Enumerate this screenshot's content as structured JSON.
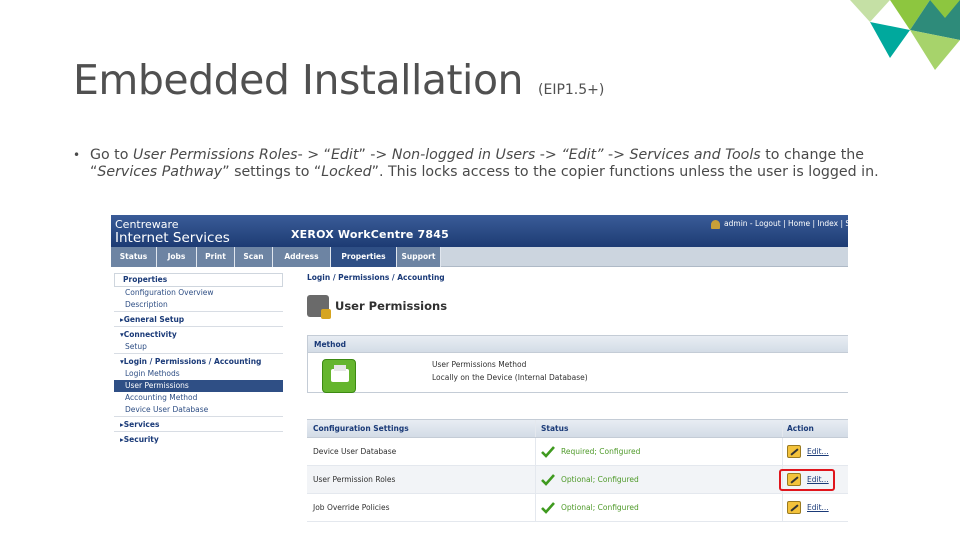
{
  "slide": {
    "title": "Embedded Installation",
    "subtitle": "(EIP1.5+)",
    "bullet": {
      "marker": "•",
      "parts": [
        {
          "text": "Go to ",
          "italic": false
        },
        {
          "text": "User Permissions Roles",
          "italic": true
        },
        {
          "text": "- > “",
          "italic": false
        },
        {
          "text": "Edit",
          "italic": true
        },
        {
          "text": "” -> ",
          "italic": false
        },
        {
          "text": "Non-logged in Users",
          "italic": true
        },
        {
          "text": " -> ",
          "italic": false
        },
        {
          "text": "“Edit”",
          "italic": true
        },
        {
          "text": " -> ",
          "italic": false
        },
        {
          "text": "Services and Tools",
          "italic": true
        },
        {
          "text": " to change the “",
          "italic": false
        },
        {
          "text": "Services Pathway",
          "italic": true
        },
        {
          "text": "” settings to “",
          "italic": false
        },
        {
          "text": "Locked",
          "italic": true
        },
        {
          "text": "”. This locks access to the copier functions unless the user is logged in.",
          "italic": false
        }
      ]
    },
    "accent_colors": [
      "#8dc63f",
      "#00a99d",
      "#c5e0a5",
      "#2e8b7a"
    ]
  },
  "screenshot": {
    "brand_line1": "Centreware",
    "brand_line2": "Internet Services",
    "device_name": "XEROX WorkCentre 7845",
    "user_links": "admin - Logout | Home | Index | Site Map",
    "tabs": [
      {
        "label": "Status",
        "active": false
      },
      {
        "label": "Jobs",
        "active": false
      },
      {
        "label": "Print",
        "active": false
      },
      {
        "label": "Scan",
        "active": false
      },
      {
        "label": "Address Book",
        "active": false
      },
      {
        "label": "Properties",
        "active": true
      },
      {
        "label": "Support",
        "active": false
      }
    ],
    "nav": {
      "header": "Properties",
      "items": [
        {
          "label": "Configuration Overview",
          "type": "item"
        },
        {
          "label": "Description",
          "type": "item"
        },
        {
          "label": "▸General Setup",
          "type": "group"
        },
        {
          "label": "▾Connectivity",
          "type": "group"
        },
        {
          "label": "Setup",
          "type": "item"
        },
        {
          "label": "▾Login / Permissions / Accounting",
          "type": "group"
        },
        {
          "label": "Login Methods",
          "type": "item"
        },
        {
          "label": "User Permissions",
          "type": "selected"
        },
        {
          "label": "Accounting Method",
          "type": "item"
        },
        {
          "label": "Device User Database",
          "type": "item"
        },
        {
          "label": "▸Services",
          "type": "group"
        },
        {
          "label": "▸Security",
          "type": "group"
        }
      ]
    },
    "breadcrumb": "Login / Permissions / Accounting",
    "page_title": "User Permissions",
    "method": {
      "header": "Method",
      "label": "User Permissions Method",
      "value": "Locally on the Device (Internal Database)"
    },
    "table": {
      "headers": [
        "Configuration Settings",
        "Status",
        "Action"
      ],
      "rows": [
        {
          "setting": "Device User Database",
          "status": "Required; Configured",
          "action": "Edit..."
        },
        {
          "setting": "User Permission Roles",
          "status": "Optional; Configured",
          "action": "Edit..."
        },
        {
          "setting": "Job Override Policies",
          "status": "Optional; Configured",
          "action": "Edit..."
        }
      ],
      "highlighted_row": 1,
      "highlight_color": "#e0151c"
    }
  }
}
